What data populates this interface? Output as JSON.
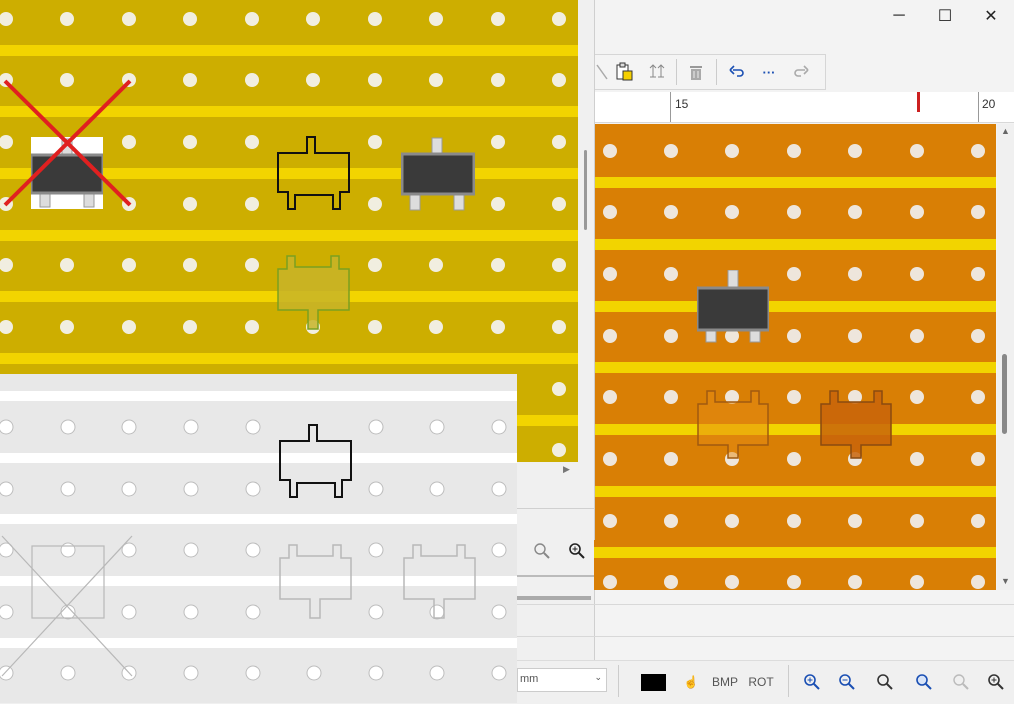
{
  "window": {
    "minimize_icon": "─",
    "maximize_icon": "☐",
    "close_icon": "✕"
  },
  "toolbar": {
    "icons": [
      "cut-icon",
      "paste-icon",
      "transistor-icon",
      "delete-icon",
      "undo-icon",
      "more-icon",
      "redo-icon"
    ]
  },
  "ruler": {
    "label_15": "15",
    "label_20": "20",
    "marker_color": "#cc2020"
  },
  "statusbar": {
    "unit_value": "mm",
    "bmp_label": "BMP",
    "rot_label": "ROT",
    "color_swatch": "#000000"
  },
  "colors": {
    "board_yellow": "#cdae00",
    "strip_yellow": "#f2d400",
    "board_orange": "#d97f05",
    "board_gray": "#e8e8e8",
    "delete_cross": "#e02020"
  }
}
